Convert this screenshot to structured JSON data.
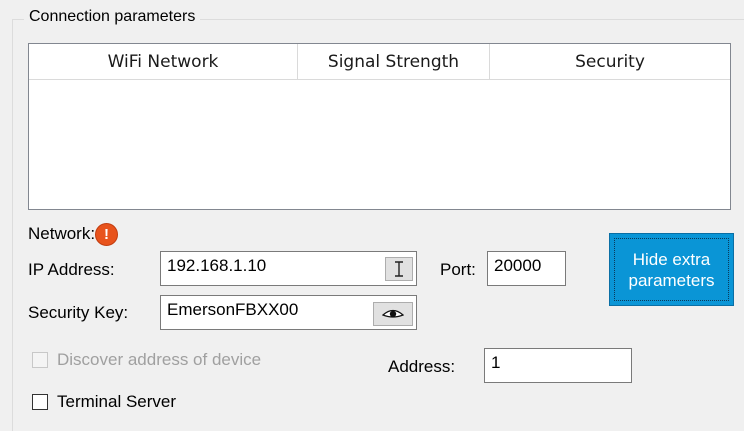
{
  "group": {
    "title": "Connection parameters"
  },
  "wifi_table": {
    "columns": [
      "WiFi Network",
      "Signal Strength",
      "Security"
    ]
  },
  "network": {
    "label": "Network:",
    "status_icon": "warning-icon"
  },
  "ip": {
    "label": "IP Address:",
    "value": "192.168.1.10",
    "button_icon": "text-cursor-icon"
  },
  "port": {
    "label": "Port:",
    "value": "20000"
  },
  "security": {
    "label": "Security Key:",
    "value": "EmersonFBXX00",
    "button_icon": "eye-icon"
  },
  "hide_button": {
    "line1": "Hide extra",
    "line2": "parameters",
    "color": "#0a95d6"
  },
  "discover": {
    "label": "Discover address of device",
    "checked": false,
    "enabled": false
  },
  "address": {
    "label": "Address:",
    "value": "1"
  },
  "terminal": {
    "label": "Terminal Server",
    "checked": false
  }
}
